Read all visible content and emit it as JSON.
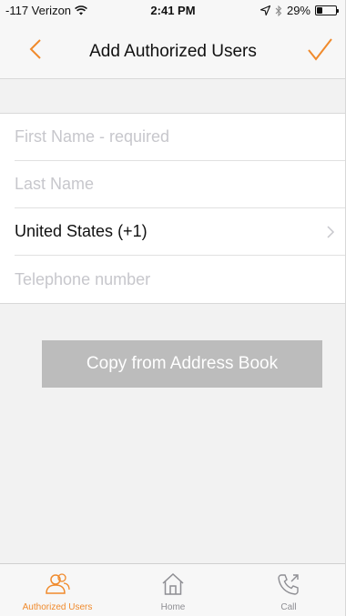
{
  "status": {
    "carrier": "-117 Verizon",
    "time": "2:41 PM",
    "battery": "29%",
    "battery_level": 0.29
  },
  "nav": {
    "title": "Add Authorized Users",
    "accent_color": "#f08a2c"
  },
  "form": {
    "first_name_placeholder": "First Name - required",
    "last_name_placeholder": "Last Name",
    "country": "United States (+1)",
    "phone_placeholder": "Telephone number"
  },
  "copy_button_label": "Copy from Address Book",
  "tabs": [
    {
      "label": "Authorized Users",
      "icon": "users-icon",
      "active": true
    },
    {
      "label": "Home",
      "icon": "home-icon",
      "active": false
    },
    {
      "label": "Call",
      "icon": "phone-icon",
      "active": false
    }
  ]
}
